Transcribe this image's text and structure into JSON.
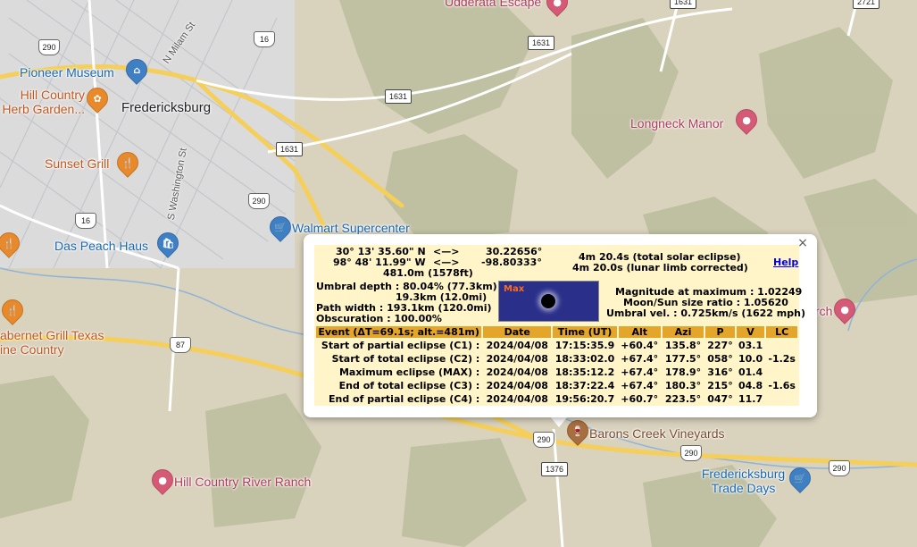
{
  "map": {
    "poi": [
      {
        "name": "udderata-escape",
        "label": "Udderata Escape",
        "color": "pink"
      },
      {
        "name": "pioneer-museum",
        "label": "Pioneer Museum",
        "color": "blue"
      },
      {
        "name": "hill-country-herb",
        "label": "Hill Country Herb Garden...",
        "color": "orange"
      },
      {
        "name": "fredericksburg",
        "label": "Fredericksburg",
        "color": "city"
      },
      {
        "name": "sunset-grill",
        "label": "Sunset Grill",
        "color": "orange"
      },
      {
        "name": "walmart",
        "label": "Walmart Supercenter",
        "color": "blue"
      },
      {
        "name": "das-peach-haus",
        "label": "Das Peach Haus",
        "color": "blue"
      },
      {
        "name": "longneck-manor",
        "label": "Longneck Manor",
        "color": "pink"
      },
      {
        "name": "cabernet-grill",
        "label": "abernet Grill Texas ine Country",
        "color": "orange"
      },
      {
        "name": "barons-creek",
        "label": "Barons Creek Vineyards",
        "color": "brown"
      },
      {
        "name": "hill-country-river-ranch",
        "label": "Hill Country River Ranch",
        "color": "pink"
      },
      {
        "name": "fredericksburg-trade-days",
        "label": "Fredericksburg Trade Days",
        "color": "blue"
      },
      {
        "name": "rch-partial",
        "label": "rch",
        "color": "pink"
      }
    ],
    "streets": [
      "N Milam St",
      "S Washington St"
    ],
    "shields": [
      "290",
      "16",
      "290",
      "16",
      "87",
      "290",
      "290",
      "290"
    ],
    "ranch_roads": [
      "1631",
      "1631",
      "1631",
      "1631",
      "2721",
      "1376"
    ]
  },
  "popup": {
    "close_label": "×",
    "help_label": "Help",
    "coords": {
      "lat_dms": "30° 13' 35.60\" N",
      "lon_dms": "98° 48' 11.99\" W",
      "arrow1": "<—>",
      "arrow2": "<—>",
      "lat_dec": "30.22656°",
      "lon_dec": "-98.80333°",
      "elevation": "481.0m (1578ft)"
    },
    "duration_total": "4m 20.4s (total solar eclipse)",
    "duration_limb": "4m 20.0s (lunar limb corrected)",
    "umbral_depth": "Umbral depth : 80.04% (77.3km)",
    "umbral_depth2": "19.3km (12.0mi)",
    "path_width": "Path width : 193.1km (120.0mi)",
    "obscuration": "Obscuration : 100.00%",
    "max_label": "Max",
    "magnitude": "Magnitude at maximum : 1.02249",
    "size_ratio": "Moon/Sun size ratio : 1.05620",
    "umbral_vel": "Umbral vel. : 0.725km/s (1622 mph)",
    "table": {
      "headers": [
        "Event (ΔT=69.1s; alt.=481m)",
        "Date",
        "Time (UT)",
        "Alt",
        "Azi",
        "P",
        "V",
        "LC"
      ],
      "rows": [
        [
          "Start of partial eclipse (C1) :",
          "2024/04/08",
          "17:15:35.9",
          "+60.4°",
          "135.8°",
          "227°",
          "03.1",
          ""
        ],
        [
          "Start of total eclipse (C2) :",
          "2024/04/08",
          "18:33:02.0",
          "+67.4°",
          "177.5°",
          "058°",
          "10.0",
          "-1.2s"
        ],
        [
          "Maximum eclipse (MAX) :",
          "2024/04/08",
          "18:35:12.2",
          "+67.4°",
          "178.9°",
          "316°",
          "01.4",
          ""
        ],
        [
          "End of total eclipse (C3) :",
          "2024/04/08",
          "18:37:22.4",
          "+67.4°",
          "180.3°",
          "215°",
          "04.8",
          "-1.6s"
        ],
        [
          "End of partial eclipse (C4) :",
          "2024/04/08",
          "19:56:20.7",
          "+60.7°",
          "223.5°",
          "047°",
          "11.7",
          ""
        ]
      ]
    }
  }
}
